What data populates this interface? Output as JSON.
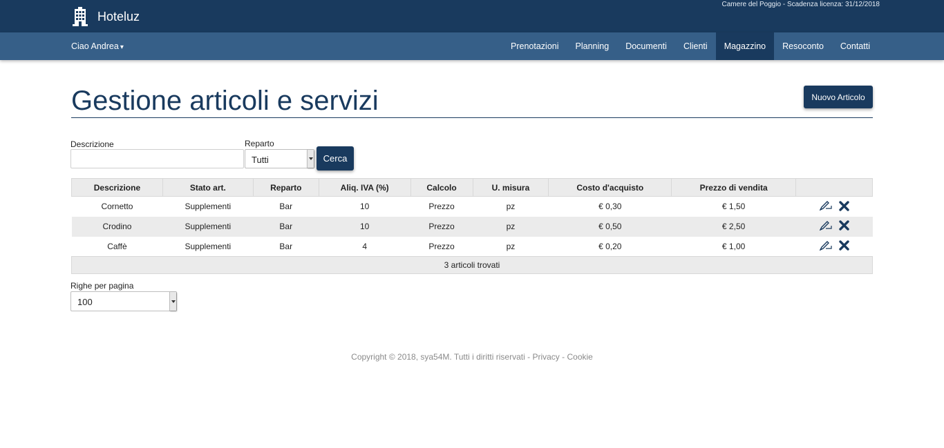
{
  "app": {
    "title": "Hoteluz",
    "license": "Camere del Poggio - Scadenza licenza: 31/12/2018",
    "brand_color": "#193a5e",
    "nav_color": "#365f88"
  },
  "navbar": {
    "user_menu": "Ciao Andrea",
    "items": [
      {
        "label": "Prenotazioni"
      },
      {
        "label": "Planning"
      },
      {
        "label": "Documenti"
      },
      {
        "label": "Clienti"
      },
      {
        "label": "Magazzino",
        "active": true
      },
      {
        "label": "Resoconto"
      },
      {
        "label": "Contatti"
      }
    ]
  },
  "page": {
    "title": "Gestione articoli e servizi",
    "new_button": "Nuovo Articolo"
  },
  "filters": {
    "description_label": "Descrizione",
    "description_value": "",
    "department_label": "Reparto",
    "department_selected": "Tutti",
    "search_button": "Cerca"
  },
  "table": {
    "columns": [
      "Descrizione",
      "Stato art.",
      "Reparto",
      "Aliq. IVA (%)",
      "Calcolo",
      "U. misura",
      "Costo d'acquisto",
      "Prezzo di vendita",
      ""
    ],
    "rows": [
      [
        "Cornetto",
        "Supplementi",
        "Bar",
        "10",
        "Prezzo",
        "pz",
        "€ 0,30",
        "€ 1,50"
      ],
      [
        "Crodino",
        "Supplementi",
        "Bar",
        "10",
        "Prezzo",
        "pz",
        "€ 0,50",
        "€ 2,50"
      ],
      [
        "Caffè",
        "Supplementi",
        "Bar",
        "4",
        "Prezzo",
        "pz",
        "€ 0,20",
        "€ 1,00"
      ]
    ],
    "row_icons": [
      "edit-icon",
      "delete-icon"
    ],
    "footer": "3 articoli trovati"
  },
  "pagination": {
    "rows_per_page_label": "Righe per pagina",
    "rows_per_page_value": "100"
  },
  "footer": {
    "copyright": "Copyright © 2018, sya54M. Tutti i diritti riservati",
    "separator": "-",
    "privacy": "Privacy",
    "cookie": "Cookie"
  }
}
